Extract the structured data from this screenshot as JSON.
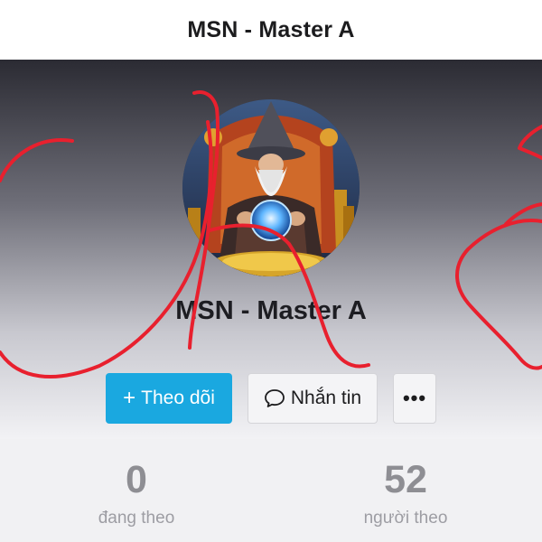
{
  "header": {
    "title": "MSN - Master A"
  },
  "profile": {
    "name": "MSN - Master A",
    "avatar_icon": "wizard-avatar"
  },
  "actions": {
    "follow_label": "Theo dõi",
    "follow_icon": "plus-icon",
    "message_label": "Nhắn tin",
    "message_icon": "chat-bubble-icon",
    "more_label": "•••",
    "more_icon": "more-dots-icon"
  },
  "stats": {
    "following": {
      "count": "0",
      "label": "đang theo"
    },
    "followers": {
      "count": "52",
      "label": "người theo"
    }
  },
  "colors": {
    "accent": "#1aa8e0",
    "annotation": "#e8202e"
  }
}
